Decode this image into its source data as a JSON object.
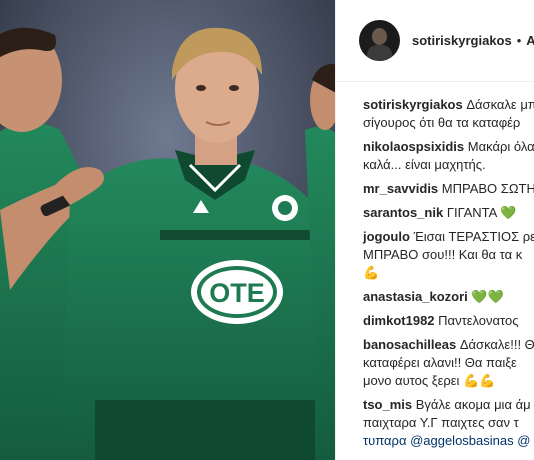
{
  "post": {
    "author": "sotiriskyrgiakos",
    "separator": "•",
    "follow_label": "Ακ"
  },
  "comments": [
    {
      "user": "sotiriskyrgiakos",
      "lines": [
        "Δάσκαλε μπ",
        "σίγουρος ότι θα τα καταφέρ"
      ]
    },
    {
      "user": "nikolaospsixidis",
      "lines": [
        "Μακάρι όλα",
        "καλά... είναι μαχητής."
      ]
    },
    {
      "user": "mr_savvidis",
      "lines": [
        "ΜΠΡΑΒΟ ΣΩΤΗ"
      ]
    },
    {
      "user": "sarantos_nik",
      "lines": [
        "ΓΙΓΑΝΤΑ"
      ],
      "emoji": "green-heart"
    },
    {
      "user": "jogoulo",
      "lines": [
        "Έισαι ΤΕΡΑΣΤΙΟΣ ρε",
        "ΜΠΡΑΒΟ σου!!! Και θα τα κ"
      ],
      "emoji_line": "muscle"
    },
    {
      "user": "anastasia_kozori",
      "lines": [
        ""
      ],
      "emoji": "two-green-hearts"
    },
    {
      "user": "dimkot1982",
      "lines": [
        "Παντελονατος"
      ]
    },
    {
      "user": "banosachilleas",
      "lines": [
        "Δάσκαλε!!! Θ",
        "καταφέρει αλανι!! Θα παιξε",
        "μονο αυτος ξερει"
      ]
    },
    {
      "user": "tso_mis",
      "lines": [
        "Βγάλε ακομα μια άμ",
        "παιχταρα Υ.Γ παιχτες σαν τ",
        "τυπαρα @aggelosbasinas @"
      ]
    }
  ],
  "emoji": {
    "green_heart": "💚",
    "muscle": "💪"
  },
  "photo": {
    "jersey_sponsor": "OTE",
    "kit_color": "#1f7a52"
  }
}
